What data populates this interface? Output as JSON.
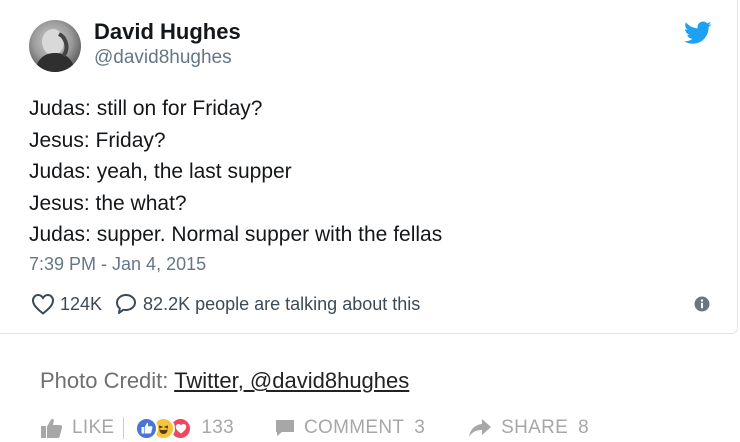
{
  "tweet": {
    "author_name": "David Hughes",
    "author_handle": "@david8hughes",
    "lines": [
      "Judas: still on for Friday?",
      "Jesus: Friday?",
      "Judas: yeah, the last supper",
      "Jesus: the what?",
      "Judas: supper. Normal supper with the fellas"
    ],
    "timestamp": "7:39 PM - Jan 4, 2015",
    "likes": "124K",
    "talking": "82.2K people are talking about this",
    "icons": {
      "brand": "twitter-bird-icon",
      "like": "heart-outline-icon",
      "reply": "speech-bubble-icon",
      "info": "info-icon"
    },
    "colors": {
      "brand": "#1da1f2",
      "handle": "#657786"
    }
  },
  "credit": {
    "label": "Photo Credit:",
    "link_text": "Twitter, @david8hughes"
  },
  "facebook_bar": {
    "like_label": "LIKE",
    "reactions": [
      "like",
      "haha",
      "love"
    ],
    "reaction_count": "133",
    "comment_label": "COMMENT",
    "comment_count": "3",
    "share_label": "SHARE",
    "share_count": "8",
    "colors": {
      "text": "#a7a7a7",
      "like_reaction": "#4a74d6",
      "haha_reaction": "#f6c43a",
      "love_reaction": "#f0475c"
    }
  }
}
